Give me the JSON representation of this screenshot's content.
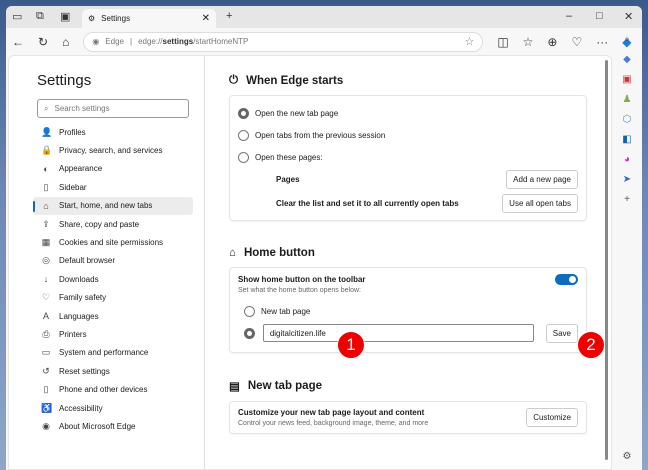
{
  "tab": {
    "title": "Settings"
  },
  "address": {
    "site": "Edge",
    "url_prefix": "edge://",
    "url_bold": "settings",
    "url_rest": "/startHomeNTP"
  },
  "sidebar": {
    "title": "Settings",
    "search_placeholder": "Search settings",
    "items": [
      {
        "label": "Profiles",
        "icon": "👤"
      },
      {
        "label": "Privacy, search, and services",
        "icon": "🔒"
      },
      {
        "label": "Appearance",
        "icon": "◐"
      },
      {
        "label": "Sidebar",
        "icon": "▯"
      },
      {
        "label": "Start, home, and new tabs",
        "icon": "⌂"
      },
      {
        "label": "Share, copy and paste",
        "icon": "⇪"
      },
      {
        "label": "Cookies and site permissions",
        "icon": "▦"
      },
      {
        "label": "Default browser",
        "icon": "◎"
      },
      {
        "label": "Downloads",
        "icon": "↓"
      },
      {
        "label": "Family safety",
        "icon": "♡"
      },
      {
        "label": "Languages",
        "icon": "A"
      },
      {
        "label": "Printers",
        "icon": "⎙"
      },
      {
        "label": "System and performance",
        "icon": "▭"
      },
      {
        "label": "Reset settings",
        "icon": "↺"
      },
      {
        "label": "Phone and other devices",
        "icon": "▯"
      },
      {
        "label": "Accessibility",
        "icon": "♿"
      },
      {
        "label": "About Microsoft Edge",
        "icon": "◉"
      }
    ]
  },
  "when_starts": {
    "title": "When Edge starts",
    "options": [
      "Open the new tab page",
      "Open tabs from the previous session",
      "Open these pages:"
    ],
    "pages_label": "Pages",
    "add_page": "Add a new page",
    "clear_label": "Clear the list and set it to all currently open tabs",
    "use_all": "Use all open tabs"
  },
  "home": {
    "title": "Home button",
    "show_label": "Show home button on the toolbar",
    "show_on": true,
    "sub": "Set what the home button opens below:",
    "opt_newtab": "New tab page",
    "url_value": "digitalcitizen.life",
    "save": "Save"
  },
  "badges": [
    "1",
    "2"
  ],
  "ntp": {
    "title": "New tab page",
    "custom_label": "Customize your new tab page layout and content",
    "custom_sub": "Control your news feed, background image, theme, and more",
    "customize": "Customize"
  }
}
